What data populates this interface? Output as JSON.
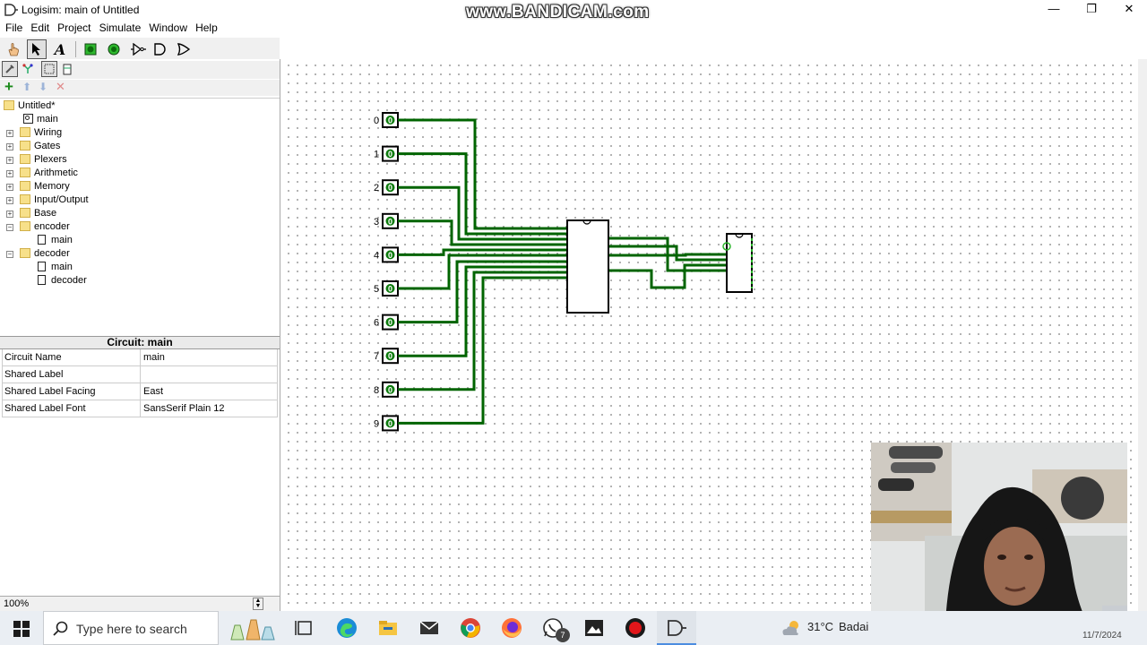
{
  "window": {
    "title": "Logisim: main of Untitled",
    "watermark": "www.BANDICAM.com",
    "controls": {
      "minimize": "—",
      "maximize": "❐",
      "close": "✕"
    }
  },
  "menu": [
    "File",
    "Edit",
    "Project",
    "Simulate",
    "Window",
    "Help"
  ],
  "toolbar": {
    "tools": [
      "poke-tool-icon",
      "select-tool-icon",
      "text-tool-icon",
      "input-pin-icon",
      "output-pin-icon",
      "not-gate-icon",
      "and-gate-icon",
      "or-gate-icon"
    ],
    "text_tool_label": "A"
  },
  "explorer": {
    "project": "Untitled*",
    "items": [
      {
        "label": "main",
        "kind": "circuit"
      },
      {
        "label": "Wiring",
        "kind": "folder"
      },
      {
        "label": "Gates",
        "kind": "folder"
      },
      {
        "label": "Plexers",
        "kind": "folder"
      },
      {
        "label": "Arithmetic",
        "kind": "folder"
      },
      {
        "label": "Memory",
        "kind": "folder"
      },
      {
        "label": "Input/Output",
        "kind": "folder"
      },
      {
        "label": "Base",
        "kind": "folder"
      },
      {
        "label": "encoder",
        "kind": "folder"
      },
      {
        "label": "main",
        "kind": "circuit"
      },
      {
        "label": "decoder",
        "kind": "folder"
      },
      {
        "label": "main",
        "kind": "circuit"
      },
      {
        "label": "decoder",
        "kind": "circuit"
      }
    ]
  },
  "attributes": {
    "title": "Circuit: main",
    "rows": [
      {
        "key": "Circuit Name",
        "value": "main"
      },
      {
        "key": "Shared Label",
        "value": ""
      },
      {
        "key": "Shared Label Facing",
        "value": "East"
      },
      {
        "key": "Shared Label Font",
        "value": "SansSerif Plain 12"
      }
    ]
  },
  "zoom": "100%",
  "canvas": {
    "pins": [
      {
        "label": "0",
        "value": "0"
      },
      {
        "label": "1",
        "value": "0"
      },
      {
        "label": "2",
        "value": "0"
      },
      {
        "label": "3",
        "value": "0"
      },
      {
        "label": "4",
        "value": "0"
      },
      {
        "label": "5",
        "value": "0"
      },
      {
        "label": "6",
        "value": "0"
      },
      {
        "label": "7",
        "value": "0"
      },
      {
        "label": "8",
        "value": "0"
      },
      {
        "label": "9",
        "value": "0"
      }
    ],
    "wire_color": "#006400"
  },
  "taskbar": {
    "search_placeholder": "Type here to search",
    "apps": [
      "task-view-icon",
      "edge-icon",
      "file-explorer-icon",
      "mail-icon",
      "chrome-icon",
      "firefox-icon",
      "whatsapp-icon",
      "photos-icon",
      "record-icon",
      "logisim-icon"
    ],
    "whatsapp_badge": "7",
    "weather_temp": "31°C",
    "weather_text": "Badai",
    "date": "11/7/2024"
  }
}
